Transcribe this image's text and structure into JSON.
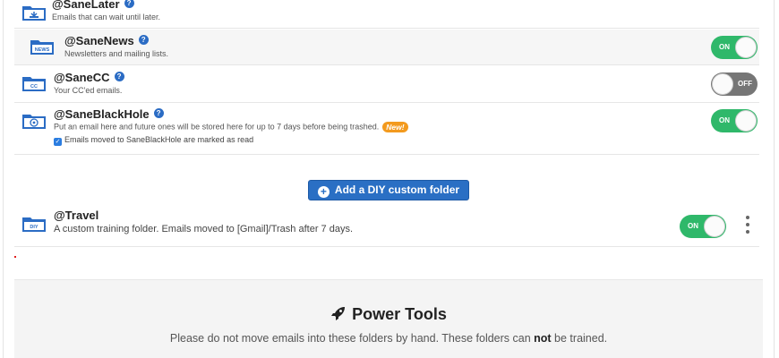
{
  "folders": [
    {
      "name": "@SaneLater",
      "description": "Emails that can wait until later.",
      "icon": "folder-later-icon"
    },
    {
      "name": "@SaneNews",
      "description": "Newsletters and mailing lists.",
      "icon": "folder-news-icon",
      "icon_text": "NEWS",
      "toggle": "ON"
    },
    {
      "name": "@SaneCC",
      "description": "Your CC'ed emails.",
      "icon": "folder-cc-icon",
      "icon_text": "CC",
      "toggle": "OFF"
    },
    {
      "name": "@SaneBlackHole",
      "description": "Put an email here and future ones will be stored here for up to 7 days before being trashed.",
      "badge": "New!",
      "checkbox_label": "Emails moved to SaneBlackHole are marked as read",
      "checkbox_checked": true,
      "icon": "folder-blackhole-icon",
      "toggle": "ON"
    }
  ],
  "add_button": {
    "label": "Add a DIY custom folder",
    "icon": "plus-circle-icon"
  },
  "custom_folder": {
    "name": "@Travel",
    "description": "A custom training folder. Emails moved to [Gmail]/Trash after 7 days.",
    "icon": "folder-diy-icon",
    "icon_text": "DIY",
    "toggle": "ON"
  },
  "power_tools": {
    "title": "Power Tools",
    "icon": "rocket-icon",
    "subtitle_before": "Please do not move emails into these folders by hand. These folders can ",
    "subtitle_bold": "not",
    "subtitle_after": " be trained."
  },
  "colors": {
    "toggle_on": "#2fb86a",
    "toggle_off": "#767676",
    "folder_blue": "#2b6cc4",
    "button_blue": "#2a6fc4",
    "badge_orange": "#f39a1e"
  }
}
